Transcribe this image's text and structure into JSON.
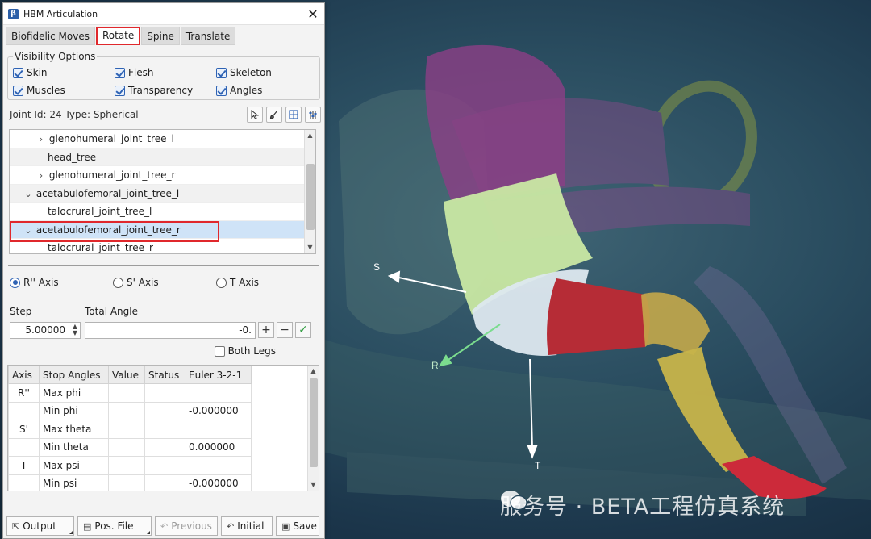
{
  "window": {
    "title": "HBM Articulation",
    "close_glyph": "✕"
  },
  "tabs": [
    {
      "label": "Biofidelic Moves"
    },
    {
      "label": "Rotate"
    },
    {
      "label": "Spine"
    },
    {
      "label": "Translate"
    }
  ],
  "visibility": {
    "legend": "Visibility Options",
    "items": [
      {
        "label": "Skin",
        "checked": true
      },
      {
        "label": "Flesh",
        "checked": true
      },
      {
        "label": "Skeleton",
        "checked": true
      },
      {
        "label": "Muscles",
        "checked": true
      },
      {
        "label": "Transparency",
        "checked": true
      },
      {
        "label": "Angles",
        "checked": true
      }
    ]
  },
  "joint": {
    "info": "Joint Id: 24 Type: Spherical",
    "tools": [
      "pointer-icon",
      "brush-icon",
      "grid-icon",
      "sliders-icon"
    ]
  },
  "tree": {
    "rows": [
      {
        "label": "glenohumeral_joint_tree_l",
        "expander": "›",
        "indent": 1
      },
      {
        "label": "head_tree",
        "expander": "",
        "indent": 2
      },
      {
        "label": "glenohumeral_joint_tree_r",
        "expander": "›",
        "indent": 1
      },
      {
        "label": "acetabulofemoral_joint_tree_l",
        "expander": "⌄",
        "indent": 0
      },
      {
        "label": "talocrural_joint_tree_l",
        "expander": "",
        "indent": 2
      },
      {
        "label": "acetabulofemoral_joint_tree_r",
        "expander": "⌄",
        "indent": 0,
        "selected": true
      },
      {
        "label": "talocrural_joint_tree_r",
        "expander": "",
        "indent": 2
      }
    ]
  },
  "axes": [
    {
      "label": "R'' Axis",
      "selected": true
    },
    {
      "label": "S' Axis",
      "selected": false
    },
    {
      "label": "T Axis",
      "selected": false
    }
  ],
  "step": {
    "step_label": "Step",
    "angle_label": "Total Angle",
    "step_value": "5.00000",
    "angle_value": "-0.",
    "plus": "+",
    "minus": "−",
    "apply": "✓",
    "both_legs_label": "Both Legs",
    "both_legs_checked": false
  },
  "table": {
    "headers": [
      "Axis",
      "Stop Angles",
      "Value",
      "Status",
      "Euler 3-2-1"
    ],
    "rows": [
      [
        "R''",
        "Max phi",
        "",
        "",
        ""
      ],
      [
        "",
        "Min phi",
        "",
        "",
        "-0.000000"
      ],
      [
        "S'",
        "Max theta",
        "",
        "",
        ""
      ],
      [
        "",
        "Min theta",
        "",
        "",
        "0.000000"
      ],
      [
        "T",
        "Max psi",
        "",
        "",
        ""
      ],
      [
        "",
        "Min psi",
        "",
        "",
        "-0.000000"
      ]
    ]
  },
  "buttons": {
    "output": "Output",
    "pos_file": "Pos. File",
    "previous": "Previous",
    "initial": "Initial",
    "save": "Save"
  },
  "viewport": {
    "axis_labels": {
      "s": "S",
      "r": "R",
      "t": "T"
    },
    "watermark": "服务号 · BETA工程仿真系统"
  }
}
